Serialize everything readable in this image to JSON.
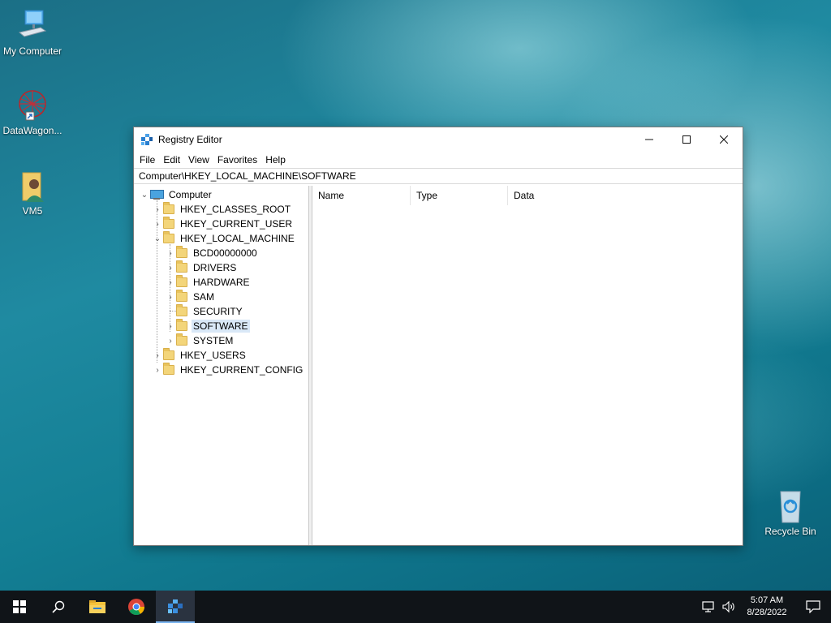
{
  "desktop": {
    "icons": [
      {
        "label": "My Computer"
      },
      {
        "label": "DataWagon..."
      },
      {
        "label": "VM5"
      },
      {
        "label": "Recycle Bin"
      }
    ]
  },
  "window": {
    "title": "Registry Editor",
    "menu": [
      "File",
      "Edit",
      "View",
      "Favorites",
      "Help"
    ],
    "address": "Computer\\HKEY_LOCAL_MACHINE\\SOFTWARE",
    "tree": {
      "root": "Computer",
      "items": [
        "HKEY_CLASSES_ROOT",
        "HKEY_CURRENT_USER",
        "HKEY_LOCAL_MACHINE",
        "BCD00000000",
        "DRIVERS",
        "HARDWARE",
        "SAM",
        "SECURITY",
        "SOFTWARE",
        "SYSTEM",
        "HKEY_USERS",
        "HKEY_CURRENT_CONFIG"
      ],
      "selected": "SOFTWARE"
    },
    "columns": [
      "Name",
      "Type",
      "Data"
    ]
  },
  "taskbar": {
    "time": "5:07 AM",
    "date": "8/28/2022"
  },
  "colors": {
    "selection": "#d9e8f7",
    "taskbar": "#101418",
    "folder": "#f3d57a"
  }
}
